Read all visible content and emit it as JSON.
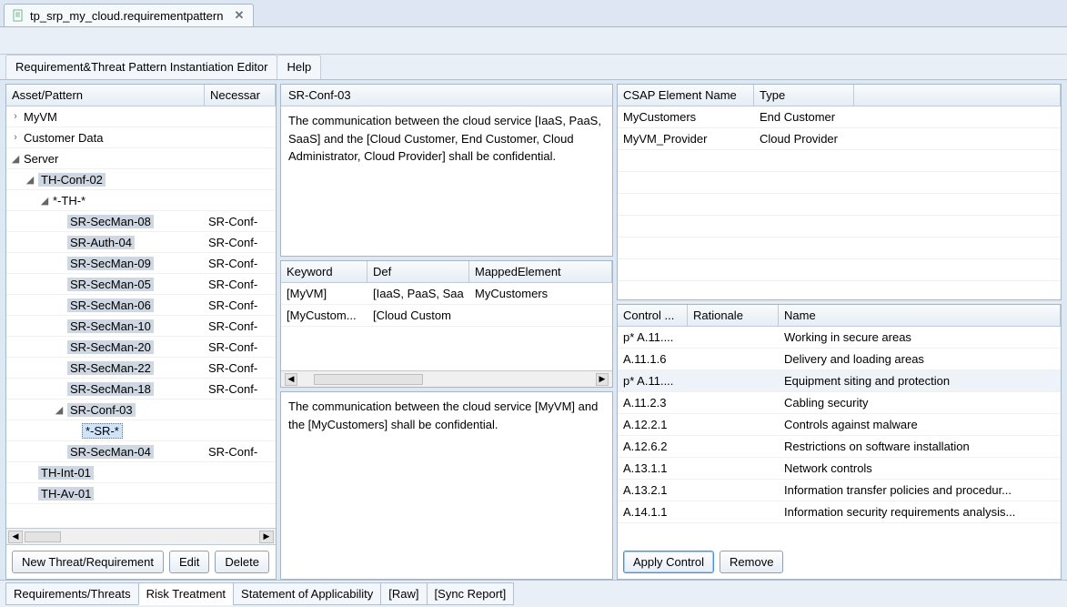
{
  "file_tab": {
    "label": "tp_srp_my_cloud.requirementpattern"
  },
  "menubar": {
    "editor": "Requirement&Threat Pattern Instantiation Editor",
    "help": "Help"
  },
  "left": {
    "headers": {
      "asset": "Asset/Pattern",
      "necessary": "Necessar"
    },
    "rows": [
      {
        "indent": 0,
        "exp": "›",
        "label": "MyVM",
        "nec": "",
        "hi": false
      },
      {
        "indent": 0,
        "exp": "›",
        "label": "Customer Data",
        "nec": "",
        "hi": false
      },
      {
        "indent": 0,
        "exp": "◢",
        "label": "Server",
        "nec": "",
        "hi": false
      },
      {
        "indent": 1,
        "exp": "◢",
        "label": "TH-Conf-02",
        "nec": "",
        "hi": true
      },
      {
        "indent": 2,
        "exp": "◢",
        "label": "*-TH-*",
        "nec": "",
        "hi": false
      },
      {
        "indent": 3,
        "exp": "",
        "label": "SR-SecMan-08",
        "nec": "SR-Conf-",
        "hi": true
      },
      {
        "indent": 3,
        "exp": "",
        "label": "SR-Auth-04",
        "nec": "SR-Conf-",
        "hi": true
      },
      {
        "indent": 3,
        "exp": "",
        "label": "SR-SecMan-09",
        "nec": "SR-Conf-",
        "hi": true
      },
      {
        "indent": 3,
        "exp": "",
        "label": "SR-SecMan-05",
        "nec": "SR-Conf-",
        "hi": true
      },
      {
        "indent": 3,
        "exp": "",
        "label": "SR-SecMan-06",
        "nec": "SR-Conf-",
        "hi": true
      },
      {
        "indent": 3,
        "exp": "",
        "label": "SR-SecMan-10",
        "nec": "SR-Conf-",
        "hi": true
      },
      {
        "indent": 3,
        "exp": "",
        "label": "SR-SecMan-20",
        "nec": "SR-Conf-",
        "hi": true
      },
      {
        "indent": 3,
        "exp": "",
        "label": "SR-SecMan-22",
        "nec": "SR-Conf-",
        "hi": true
      },
      {
        "indent": 3,
        "exp": "",
        "label": "SR-SecMan-18",
        "nec": "SR-Conf-",
        "hi": true
      },
      {
        "indent": 3,
        "exp": "◢",
        "label": "SR-Conf-03",
        "nec": "",
        "hi": true
      },
      {
        "indent": 4,
        "exp": "",
        "label": "*-SR-*",
        "nec": "",
        "sel": true
      },
      {
        "indent": 3,
        "exp": "",
        "label": "SR-SecMan-04",
        "nec": "SR-Conf-",
        "hi": true
      },
      {
        "indent": 1,
        "exp": "",
        "label": "TH-Int-01",
        "nec": "",
        "hi": true
      },
      {
        "indent": 1,
        "exp": "",
        "label": "TH-Av-01",
        "nec": "",
        "hi": true
      }
    ],
    "buttons": {
      "new": "New Threat/Requirement",
      "edit": "Edit",
      "delete": "Delete"
    }
  },
  "mid": {
    "title": "SR-Conf-03",
    "desc": "The communication between the cloud service [IaaS, PaaS, SaaS] and the [Cloud Customer, End Customer, Cloud Administrator, Cloud Provider] shall be confidential.",
    "kw_headers": {
      "keyword": "Keyword",
      "def": "Def",
      "mapped": "MappedElement"
    },
    "kw_rows": [
      {
        "keyword": "[MyVM]",
        "def": "[IaaS, PaaS, Saa",
        "mapped": "MyCustomers"
      },
      {
        "keyword": "[MyCustom...",
        "def": "[Cloud Custom",
        "mapped": ""
      }
    ],
    "instantiated": "The communication between the cloud service [MyVM] and the [MyCustomers] shall be confidential."
  },
  "right": {
    "csap_headers": {
      "name": "CSAP Element Name",
      "type": "Type"
    },
    "csap_rows": [
      {
        "name": "MyCustomers",
        "type": "End Customer"
      },
      {
        "name": "MyVM_Provider",
        "type": "Cloud Provider"
      }
    ],
    "ctrl_headers": {
      "control": "Control ...",
      "rationale": "Rationale",
      "name": "Name"
    },
    "ctrl_rows": [
      {
        "id": "p* A.11....",
        "rat": "",
        "name": "Working in secure areas",
        "hl": false
      },
      {
        "id": "A.11.1.6",
        "rat": "",
        "name": "Delivery and loading areas",
        "hl": false
      },
      {
        "id": "p* A.11....",
        "rat": "",
        "name": "Equipment siting and protection",
        "hl": true
      },
      {
        "id": "A.11.2.3",
        "rat": "",
        "name": "Cabling security",
        "hl": false
      },
      {
        "id": "A.12.2.1",
        "rat": "",
        "name": "Controls against malware",
        "hl": false
      },
      {
        "id": "A.12.6.2",
        "rat": "",
        "name": "Restrictions on software installation",
        "hl": false
      },
      {
        "id": "A.13.1.1",
        "rat": "",
        "name": "Network controls",
        "hl": false
      },
      {
        "id": "A.13.2.1",
        "rat": "",
        "name": "Information transfer policies and procedur...",
        "hl": false
      },
      {
        "id": "A.14.1.1",
        "rat": "",
        "name": "Information security requirements analysis...",
        "hl": false
      }
    ],
    "buttons": {
      "apply": "Apply Control",
      "remove": "Remove"
    }
  },
  "bottom_tabs": {
    "req": "Requirements/Threats",
    "risk": "Risk Treatment",
    "soa": "Statement of Applicability",
    "raw": "[Raw]",
    "sync": "[Sync Report]"
  }
}
